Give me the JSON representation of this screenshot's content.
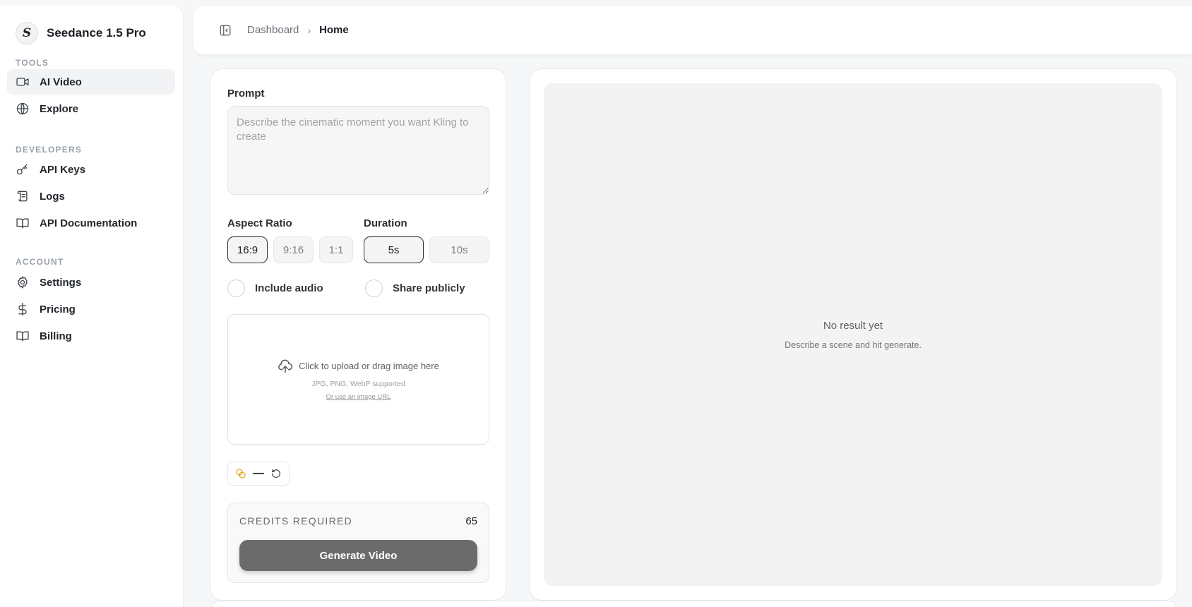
{
  "brand": {
    "logo_glyph": "S",
    "name": "Seedance 1.5 Pro"
  },
  "sidebar": {
    "sections": {
      "tools": "TOOLS",
      "developers": "DEVELOPERS",
      "account": "ACCOUNT"
    },
    "items": [
      {
        "label": "AI Video",
        "icon": "video-camera-icon",
        "active": true
      },
      {
        "label": "Explore",
        "icon": "globe-icon"
      },
      {
        "label": "API Keys",
        "icon": "key-icon"
      },
      {
        "label": "Logs",
        "icon": "scroll-icon"
      },
      {
        "label": "API Documentation",
        "icon": "open-book-icon"
      },
      {
        "label": "Settings",
        "icon": "gear-icon"
      },
      {
        "label": "Pricing",
        "icon": "dollar-icon"
      },
      {
        "label": "Billing",
        "icon": "book-icon"
      }
    ]
  },
  "header": {
    "breadcrumb_parent": "Dashboard",
    "breadcrumb_separator": "›",
    "breadcrumb_current": "Home"
  },
  "form": {
    "prompt_label": "Prompt",
    "prompt_placeholder": "Describe the cinematic moment you want Kling to create",
    "prompt_value": "",
    "aspect_label": "Aspect Ratio",
    "aspect_options": [
      "16:9",
      "9:16",
      "1:1"
    ],
    "aspect_selected": "16:9",
    "duration_label": "Duration",
    "duration_options": [
      "5s",
      "10s"
    ],
    "duration_selected": "5s",
    "include_audio_label": "Include audio",
    "include_audio_checked": false,
    "share_publicly_label": "Share publicly",
    "share_publicly_checked": false,
    "upload_main": "Click to upload or drag image here",
    "upload_formats": "JPG, PNG, WebP supported",
    "upload_url_link": "Or use an image URL",
    "credit_display": "—",
    "credits_label": "CREDITS REQUIRED",
    "credits_value": "65",
    "generate_label": "Generate Video"
  },
  "result": {
    "title": "No result yet",
    "subtitle": "Describe a scene and hit generate."
  },
  "colors": {
    "generate_button": "#6b6b6b",
    "coin_icon": "#e0a92a",
    "active_nav_bg": "#f2f3f4"
  }
}
